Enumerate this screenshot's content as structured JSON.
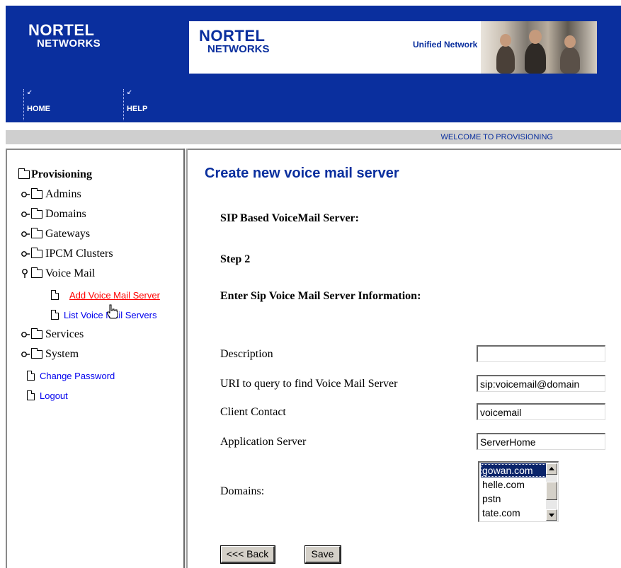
{
  "header": {
    "logo_line1": "NORTEL",
    "logo_line2": "NETWORKS",
    "banner": {
      "logo_line1": "NORTEL",
      "logo_line2": "NETWORKS",
      "tagline": "Unified Network"
    },
    "nav": [
      {
        "label": "HOME",
        "icon": "home-icon"
      },
      {
        "label": "HELP",
        "icon": "help-icon"
      }
    ],
    "welcome": "WELCOME TO PROVISIONING",
    "brand_color": "#0a2f9e"
  },
  "sidebar": {
    "root_label": "Provisioning",
    "folders": [
      {
        "label": "Admins",
        "expanded": false
      },
      {
        "label": "Domains",
        "expanded": false
      },
      {
        "label": "Gateways",
        "expanded": false
      },
      {
        "label": "IPCM Clusters",
        "expanded": false
      },
      {
        "label": "Voice Mail",
        "expanded": true
      },
      {
        "label": "Services",
        "expanded": false
      },
      {
        "label": "System",
        "expanded": false
      }
    ],
    "voice_mail_children": [
      {
        "label": "Add Voice Mail Server",
        "active": true
      },
      {
        "label": "List Voice Mail Servers",
        "active": false
      }
    ],
    "links": [
      {
        "label": "Change Password"
      },
      {
        "label": "Logout"
      }
    ]
  },
  "main": {
    "title": "Create new voice mail server",
    "subtitle": "SIP Based VoiceMail Server:",
    "step": "Step 2",
    "instruction": "Enter Sip Voice Mail Server Information:",
    "fields": {
      "description": {
        "label": "Description",
        "value": ""
      },
      "uri": {
        "label": "URI to query to find Voice Mail Server",
        "value": "sip:voicemail@domain"
      },
      "client_contact": {
        "label": "Client Contact",
        "value": "voicemail"
      },
      "app_server": {
        "label": "Application Server",
        "value": "ServerHome"
      }
    },
    "domains": {
      "label": "Domains:",
      "options": [
        "gowan.com",
        "helle.com",
        "pstn",
        "tate.com"
      ],
      "selected": "gowan.com"
    },
    "buttons": {
      "back": "<<< Back",
      "save": "Save"
    }
  }
}
